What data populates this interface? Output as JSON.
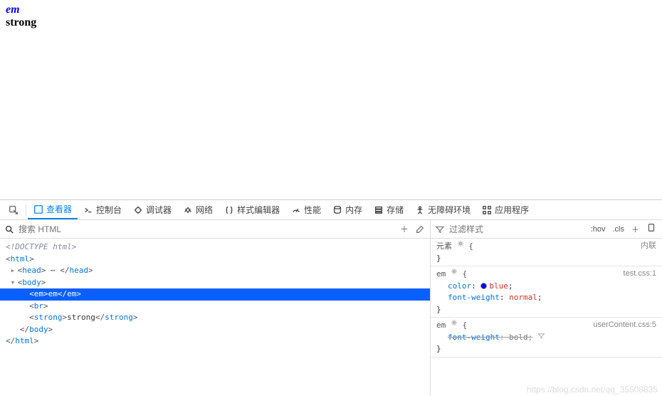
{
  "page": {
    "em_text": "em",
    "strong_text": "strong"
  },
  "toolbar": {
    "tabs": [
      {
        "id": "inspector",
        "label": "查看器",
        "icon": "box"
      },
      {
        "id": "console",
        "label": "控制台",
        "icon": "console"
      },
      {
        "id": "debugger",
        "label": "调试器",
        "icon": "bug"
      },
      {
        "id": "network",
        "label": "网络",
        "icon": "network"
      },
      {
        "id": "style",
        "label": "样式编辑器",
        "icon": "braces"
      },
      {
        "id": "perf",
        "label": "性能",
        "icon": "gauge"
      },
      {
        "id": "memory",
        "label": "内存",
        "icon": "db"
      },
      {
        "id": "storage",
        "label": "存储",
        "icon": "storage"
      },
      {
        "id": "a11y",
        "label": "无障碍环境",
        "icon": "a11y"
      },
      {
        "id": "apps",
        "label": "应用程序",
        "icon": "apps"
      }
    ],
    "active_tab": "inspector"
  },
  "dom_search": {
    "placeholder": "搜索 HTML"
  },
  "dom_lines": {
    "doctype": "<!DOCTYPE html>",
    "html_open": "html",
    "head_open": "head",
    "head_close": "head",
    "body_open": "body",
    "em_open": "em",
    "em_text": "em",
    "em_close": "em",
    "br": "br",
    "strong_open": "strong",
    "strong_text": "strong",
    "strong_close": "strong",
    "body_close": "body",
    "html_close": "html"
  },
  "styles": {
    "filter_placeholder": "过滤样式",
    "hov": ":hov",
    "cls": ".cls",
    "rules": [
      {
        "selector": "元素",
        "source": "内联",
        "props": []
      },
      {
        "selector": "em",
        "source": "test.css:1",
        "props": [
          {
            "name": "color",
            "value": "blue",
            "swatch": true
          },
          {
            "name": "font-weight",
            "value": "normal",
            "swatch": false
          }
        ]
      },
      {
        "selector": "em",
        "source": "userContent.css:5",
        "props": [
          {
            "name": "font-weight",
            "value": "bold",
            "struck": true
          }
        ]
      }
    ]
  },
  "watermark": "https://blog.csdn.net/qq_35508835"
}
